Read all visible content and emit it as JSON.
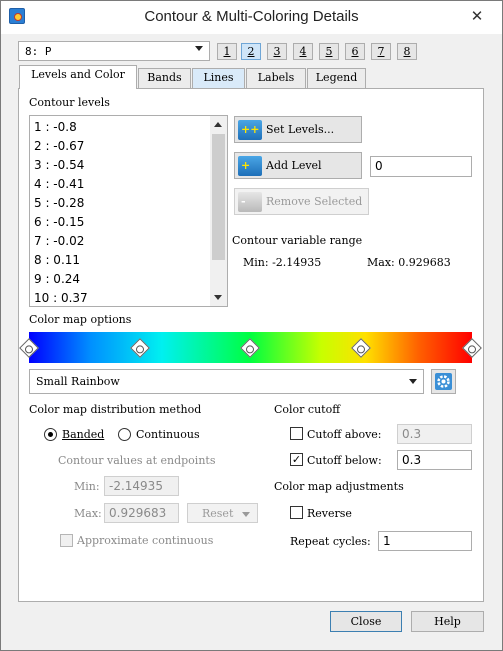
{
  "window": {
    "title": "Contour & Multi-Coloring Details",
    "close_glyph": "✕"
  },
  "group_select": {
    "value": "8: P"
  },
  "group_numbers": [
    "1",
    "2",
    "3",
    "4",
    "5",
    "6",
    "7",
    "8"
  ],
  "active_group": "2",
  "tabs": [
    {
      "label": "Levels and Color"
    },
    {
      "label": "Bands"
    },
    {
      "label": "Lines"
    },
    {
      "label": "Labels"
    },
    {
      "label": "Legend"
    }
  ],
  "levels": {
    "heading": "Contour levels",
    "items": [
      "1 : -0.8",
      "2 : -0.67",
      "3 : -0.54",
      "4 : -0.41",
      "5 : -0.28",
      "6 : -0.15",
      "7 : -0.02",
      "8 : 0.11",
      "9 : 0.24",
      "10 : 0.37"
    ],
    "set_levels_label": "Set Levels...",
    "add_level_label": "Add Level",
    "add_level_value": "0",
    "remove_selected_label": "Remove Selected"
  },
  "range": {
    "heading": "Contour variable range",
    "min_text": "Min: -2.14935",
    "max_text": "Max: 0.929683"
  },
  "colormap": {
    "heading": "Color map options",
    "selected": "Small Rainbow",
    "colors": [
      "#0000ff",
      "#0090ff",
      "#00f0f0",
      "#00ff40",
      "#c8ff00",
      "#ffe000",
      "#ff6000",
      "#ff0000"
    ]
  },
  "distribution": {
    "heading": "Color map distribution method",
    "banded_label": "Banded",
    "continuous_label": "Continuous",
    "banded_selected": true,
    "endpoints_heading": "Contour values at endpoints",
    "min_label": "Min:",
    "min_value": "-2.14935",
    "max_label": "Max:",
    "max_value": "0.929683",
    "reset_label": "Reset",
    "approx_label": "Approximate continuous"
  },
  "cutoff": {
    "heading": "Color cutoff",
    "above_label": "Cutoff above:",
    "above_value": "0.3",
    "above_checked": false,
    "below_label": "Cutoff below:",
    "below_value": "0.3",
    "below_checked": true
  },
  "adjustments": {
    "heading": "Color map adjustments",
    "reverse_label": "Reverse",
    "repeat_label": "Repeat cycles:",
    "repeat_value": "1"
  },
  "footer": {
    "close_label": "Close",
    "help_label": "Help"
  }
}
